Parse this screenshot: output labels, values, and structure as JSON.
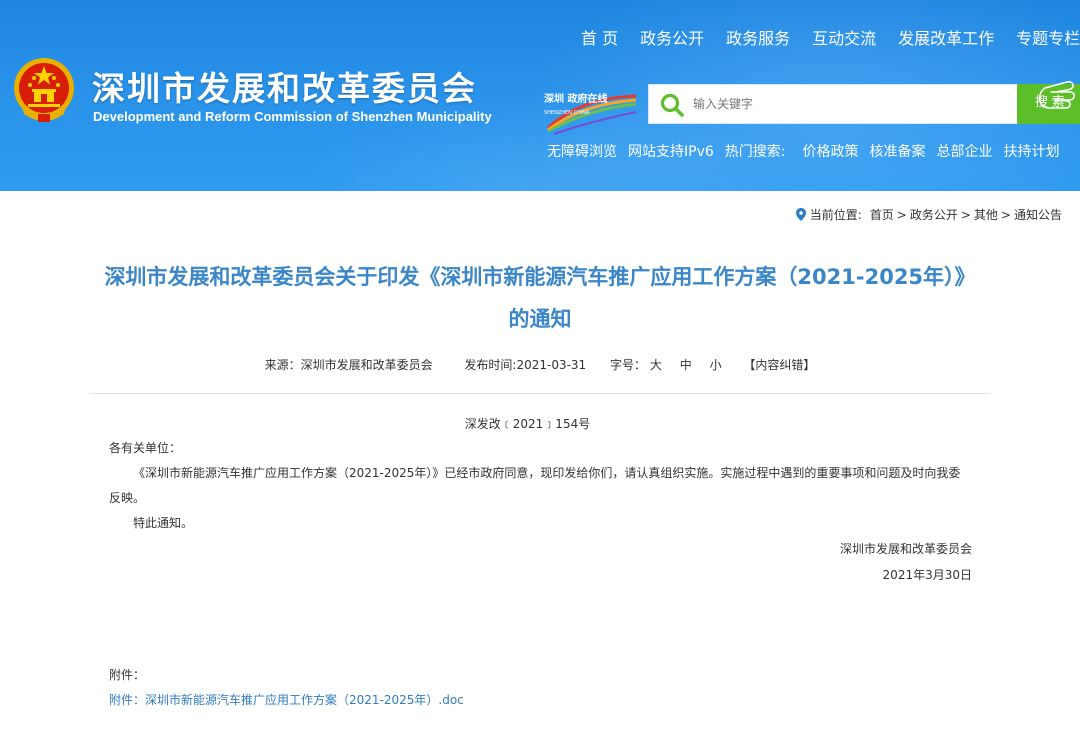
{
  "header": {
    "site_title": "深圳市发展和改革委员会",
    "site_subtitle": "Development and Reform Commission of Shenzhen Municipality",
    "nav": [
      "首 页",
      "政务公开",
      "政务服务",
      "互动交流",
      "发展改革工作",
      "专题专栏"
    ],
    "sz_logo_text": "深圳 政府在线",
    "sz_logo_sub": "SHENZHEN CHINA",
    "search": {
      "placeholder": "输入关键字",
      "button_label": "搜 索"
    },
    "quick_links": {
      "accessible": "无障碍浏览",
      "ipv6": "网站支持IPv6",
      "hot_label": "热门搜索:",
      "hot": [
        "价格政策",
        "核准备案",
        "总部企业",
        "扶持计划"
      ]
    }
  },
  "breadcrumb": {
    "prefix": "当前位置:",
    "items": [
      "首页",
      "政务公开",
      "其他",
      "通知公告"
    ],
    "separator": ">"
  },
  "article": {
    "title_line1": "深圳市发展和改革委员会关于印发《深圳市新能源汽车推广应用工作方案（2021-2025年）》",
    "title_line2": "的通知",
    "meta": {
      "source": "来源：深圳市发展和改革委员会",
      "published": "发布时间:2021-03-31",
      "font_label": "字号：",
      "font_sizes": [
        "大",
        "中",
        "小"
      ],
      "correction": "【内容纠错】"
    },
    "doc_no": "深发改﹝2021﹞154号",
    "salutation": "各有关单位：",
    "paragraph": "《深圳市新能源汽车推广应用工作方案（2021-2025年）》已经市政府同意，现印发给你们，请认真组织实施。实施过程中遇到的重要事项和问题及时向我委反映。",
    "notice": "特此通知。",
    "sign_org": "深圳市发展和改革委员会",
    "sign_date": "2021年3月30日",
    "attachment_label": "附件：",
    "attachment_link": "附件：深圳市新能源汽车推广应用工作方案（2021-2025年）.doc"
  },
  "colors": {
    "header_blue": "#2a93ea",
    "title_blue": "#3a86c8",
    "search_green": "#5cbf2a",
    "link_blue": "#2f7cc2"
  },
  "icons": [
    "national-emblem-icon",
    "shenzhen-logo-icon",
    "search-icon",
    "hand-pointer-icon",
    "location-pin-icon"
  ]
}
